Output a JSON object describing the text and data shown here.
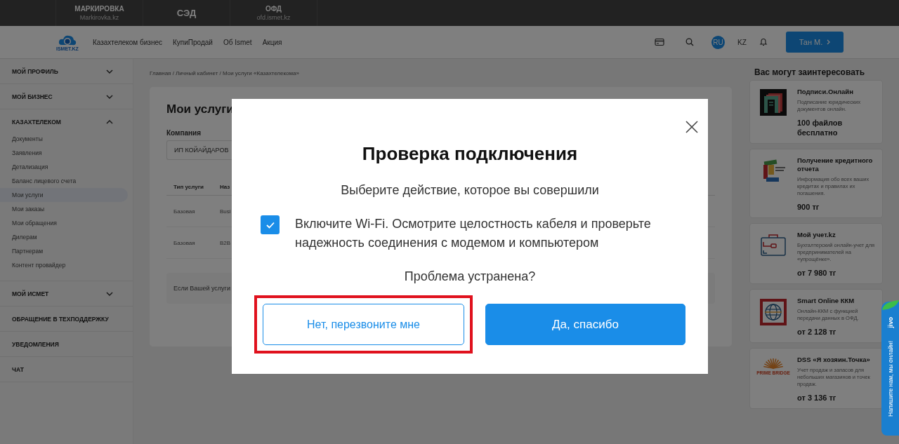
{
  "top_bar": [
    {
      "title": "МАРКИРОВКА",
      "subtitle": "Markirovka.kz"
    },
    {
      "title": "СЭД"
    },
    {
      "title": "ОФД",
      "subtitle": "ofd.ismet.kz"
    }
  ],
  "header": {
    "logo_text": "ISMET.KZ",
    "nav": [
      "Казахтелеком бизнес",
      "КупиПродай",
      "Об Ismet",
      "Акция"
    ],
    "languages": [
      {
        "label": "RU",
        "selected": true
      },
      {
        "label": "KZ",
        "selected": false
      }
    ],
    "user_button": "Тан М."
  },
  "sidebar": [
    {
      "label": "МОЙ ПРОФИЛЬ",
      "kind": "group",
      "expanded": false
    },
    {
      "label": "МОЙ БИЗНЕС",
      "kind": "group",
      "expanded": false
    },
    {
      "label": "КАЗАХТЕЛЕКОМ",
      "kind": "group",
      "expanded": true,
      "children": [
        {
          "label": "Документы",
          "selected": false
        },
        {
          "label": "Заявления",
          "selected": false
        },
        {
          "label": "Детализация",
          "selected": false
        },
        {
          "label": "Баланс лицевого счета",
          "selected": false
        },
        {
          "label": "Мои услуги",
          "selected": true
        },
        {
          "label": "Мои заказы",
          "selected": false
        },
        {
          "label": "Мои обращения",
          "selected": false
        },
        {
          "label": "Дилерам",
          "selected": false
        },
        {
          "label": "Партнерам",
          "selected": false
        },
        {
          "label": "Контент провайдер",
          "selected": false
        }
      ]
    },
    {
      "label": "МОЙ ИСМЕТ",
      "kind": "group",
      "expanded": false
    },
    {
      "label": "ОБРАЩЕНИЕ В ТЕХПОДДЕРЖКУ",
      "kind": "link"
    },
    {
      "label": "УВЕДОМЛЕНИЯ",
      "kind": "link"
    },
    {
      "label": "ЧАТ",
      "kind": "link"
    }
  ],
  "breadcrumbs": "Главная / Личный кабинет / Мои услуги «Казахтелекома»",
  "services": {
    "title": "Мои услуги",
    "company_label": "Компания",
    "company_value": "ИП КОЙАЙДАРОВ",
    "columns": [
      "Тип услуги",
      "Наз"
    ],
    "rows": [
      [
        "Базовая",
        "Busi"
      ],
      [
        "Базовая",
        "B2B"
      ]
    ],
    "notice": "Если Вашей услуги"
  },
  "offers": {
    "title": "Вас могут заинтересовать",
    "items": [
      {
        "kind": "frames",
        "name": "Подписи.Онлайн",
        "description": "Подписание юридических документов онлайн.",
        "price": "100 файлов бесплатно"
      },
      {
        "kind": "blocks",
        "name": "Получение кредитного отчета",
        "description": "Информация обо всех ваших кредитах и правилах их погашения.",
        "price": "900 тг"
      },
      {
        "kind": "briefcase",
        "name": "Мой учет.kz",
        "description": "Бухгалтерский онлайн-учет для предпринимателей на «упрощёнке».",
        "price": "от 7 980 тг"
      },
      {
        "kind": "globe",
        "name": "Smart Online ККМ",
        "description": "Онлайн-ККМ с функцией передачи данных в ОФД.",
        "price": "от 2 128 тг"
      },
      {
        "kind": "sunburst",
        "logo_text": "PRIME BRIDGE",
        "name": "DSS «Я хозяин.Точка»",
        "description": "Учет продаж и запасов для небольших магазинов и точек продаж.",
        "price": "от 3 136 тг"
      }
    ]
  },
  "modal": {
    "title": "Проверка подключения",
    "subtitle": "Выберите действие, которое вы совершили",
    "checkbox": {
      "checked": true,
      "label": "Включите Wi-Fi. Осмотрите целостность кабеля и проверьте надежность соединения с модемом и компьютером"
    },
    "question": "Проблема устранена?",
    "buttons": [
      {
        "label": "Нет, перезвоните мне",
        "kind": "secondary",
        "highlighted": true
      },
      {
        "label": "Да, спасибо",
        "kind": "primary",
        "highlighted": false
      }
    ]
  },
  "chat_widget": {
    "brand": "jivo",
    "label": "Напишите нам, мы онлайн!"
  }
}
